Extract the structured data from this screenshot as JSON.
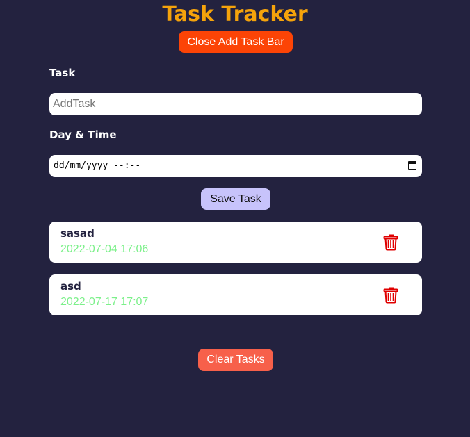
{
  "app": {
    "title": "Task Tracker",
    "accent_color": "#f5a30b",
    "background_color": "#23223f"
  },
  "header": {
    "toggle_label": "Close Add Task Bar"
  },
  "form": {
    "task_label": "Task",
    "task_placeholder": "AddTask",
    "task_value": "",
    "day_label": "Day & Time",
    "day_value": "dd/mm/yyyy --:--",
    "save_label": "Save Task"
  },
  "tasks": [
    {
      "name": "sasad",
      "datetime": "2022-07-04 17:06",
      "icon": "trash-icon"
    },
    {
      "name": "asd",
      "datetime": "2022-07-17 17:07",
      "icon": "trash-icon"
    }
  ],
  "footer": {
    "clear_label": "Clear Tasks"
  }
}
